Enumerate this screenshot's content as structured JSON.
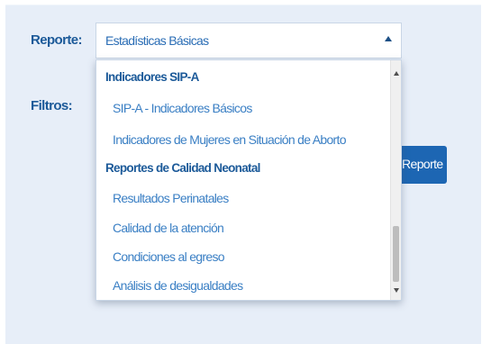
{
  "form": {
    "report_label": "Reporte:",
    "filters_label": "Filtros:",
    "report_select": {
      "selected_value": "Estadísticas Básicas",
      "expanded": true
    },
    "generate_button_label": "Reporte"
  },
  "dropdown": {
    "groups": [
      {
        "label": "Indicadores SIP-A",
        "items": [
          "SIP-A - Indicadores Básicos",
          "Indicadores de Mujeres en Situación de Aborto"
        ]
      },
      {
        "label": "Reportes de Calidad Neonatal",
        "items": [
          "Resultados Perinatales",
          "Calidad de la atención",
          "Condiciones al egreso",
          "Análisis de desigualdades"
        ]
      }
    ]
  },
  "colors": {
    "accent": "#1d66b3",
    "label_text": "#1c5a99",
    "option_text": "#3a7fc4",
    "panel_background": "#e7eef8"
  },
  "icons": {
    "select_caret": "caret-up-icon",
    "scroll_up": "scroll-up-arrow-icon",
    "scroll_down": "scroll-down-arrow-icon"
  }
}
